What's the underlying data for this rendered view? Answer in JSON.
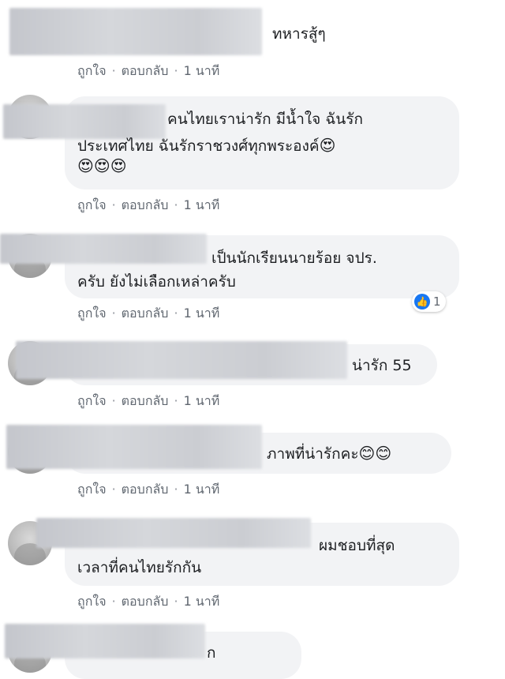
{
  "actions": {
    "like": "ถูกใจ",
    "reply": "ตอบกลับ",
    "time": "1 นาที",
    "sep": "·"
  },
  "comments": [
    {
      "text": "ทหารสู้ๆ"
    },
    {
      "line1": "คนไทยเราน่ารัก มีน้ำใจ ฉันรัก",
      "line2": "ประเทศไทย ฉันรักราชวงศ์ทุกพระองค์",
      "emoji_end": "😍",
      "emoji_line3": "😍😍😍"
    },
    {
      "line1": "เป็นนักเรียนนายร้อย จปร.",
      "line2": "ครับ ยังไม่เลือกเหล่าครับ",
      "reaction_icon": "like-icon",
      "reaction_count": "1"
    },
    {
      "text": "น่ารัก 55"
    },
    {
      "text": "ภาพที่น่ารักคะ",
      "emoji": "😊😊"
    },
    {
      "line1": "ผมชอบที่สุด",
      "line2": "เวลาที่คนไทยรักกัน"
    },
    {
      "text": "ก"
    }
  ]
}
